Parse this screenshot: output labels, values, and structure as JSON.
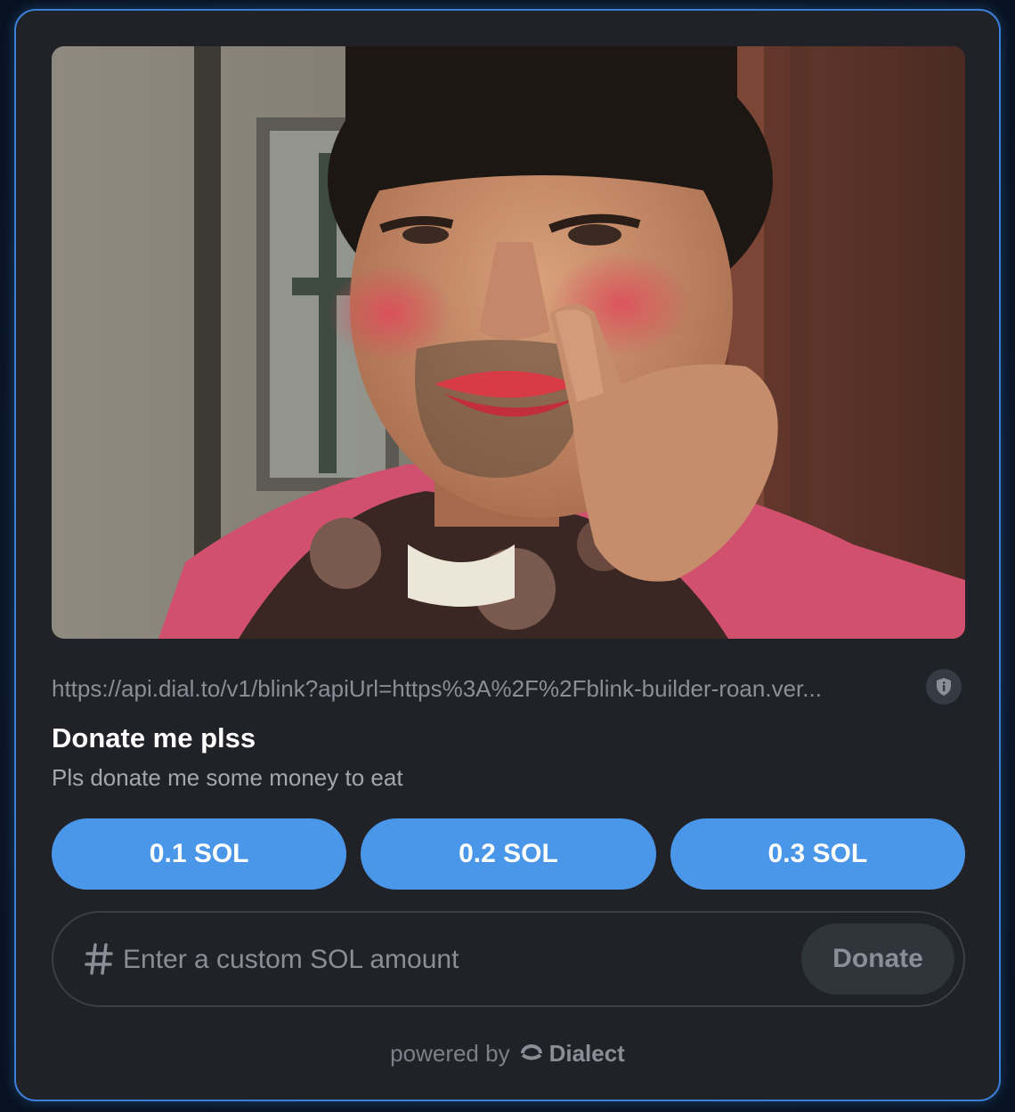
{
  "card": {
    "accent_border": "#3a7fd6",
    "background": "#202228"
  },
  "media": {
    "icon": "photo-image"
  },
  "url_row": {
    "url": "https://api.dial.to/v1/blink?apiUrl=https%3A%2F%2Fblink-builder-roan.ver...",
    "badge_icon": "shield-info-icon"
  },
  "action": {
    "title": "Donate me plss",
    "description": "Pls donate me some money to eat"
  },
  "amount_buttons": [
    {
      "label": "0.1 SOL"
    },
    {
      "label": "0.2 SOL"
    },
    {
      "label": "0.3 SOL"
    }
  ],
  "custom_amount": {
    "placeholder": "Enter a custom SOL amount",
    "value": "",
    "icon": "hash-icon",
    "submit_label": "Donate"
  },
  "footer": {
    "powered_by": "powered by",
    "brand": "Dialect",
    "brand_icon": "dialect-logo-icon"
  },
  "colors": {
    "button_blue": "#4a96e8",
    "muted_text": "#8a8e96"
  }
}
